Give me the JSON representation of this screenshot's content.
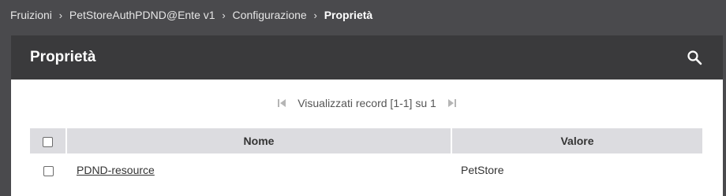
{
  "breadcrumb": {
    "items": [
      {
        "label": "Fruizioni"
      },
      {
        "label": "PetStoreAuthPDND@Ente v1"
      },
      {
        "label": "Configurazione"
      },
      {
        "label": "Proprietà"
      }
    ],
    "separator": "›"
  },
  "panel": {
    "title": "Proprietà",
    "search_icon": "search-icon"
  },
  "pager": {
    "text": "Visualizzati record [1-1] su 1",
    "first_icon": "first-page-icon",
    "last_icon": "last-page-icon"
  },
  "table": {
    "columns": [
      "Nome",
      "Valore"
    ],
    "rows": [
      {
        "nome": "PDND-resource",
        "valore": "PetStore"
      }
    ]
  },
  "colors": {
    "background": "#4a4a4d",
    "header": "#3a3a3c",
    "table_header": "#dcdce0"
  }
}
